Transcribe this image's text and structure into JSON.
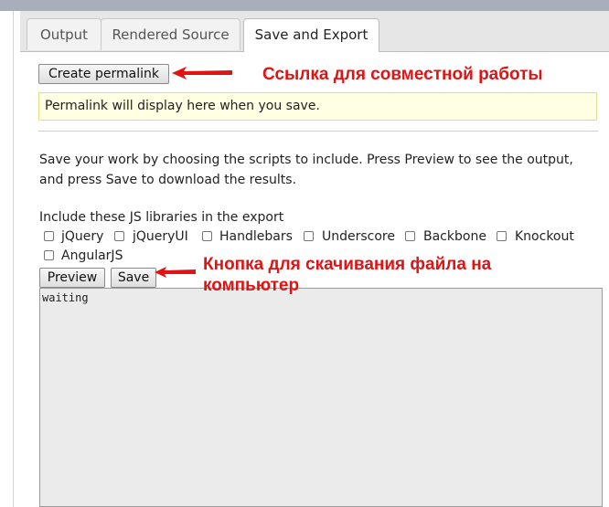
{
  "tabs": [
    {
      "label": "Output",
      "active": false
    },
    {
      "label": "Rendered Source",
      "active": false
    },
    {
      "label": "Save and Export",
      "active": true
    }
  ],
  "permalink": {
    "button_label": "Create permalink",
    "placeholder_text": "Permalink will display here when you save."
  },
  "description": "Save your work by choosing the scripts to include. Press Preview to see the output, and press Save to download the results.",
  "libraries": {
    "label": "Include these JS libraries in the export",
    "items": [
      {
        "label": "jQuery",
        "checked": false
      },
      {
        "label": "jQueryUI",
        "checked": false
      },
      {
        "label": "Handlebars",
        "checked": false
      },
      {
        "label": "Underscore",
        "checked": false
      },
      {
        "label": "Backbone",
        "checked": false
      },
      {
        "label": "Knockout",
        "checked": false
      },
      {
        "label": "AngularJS",
        "checked": false
      }
    ]
  },
  "actions": {
    "preview_label": "Preview",
    "save_label": "Save"
  },
  "output_text": "waiting",
  "annotations": {
    "permalink_note": "Ссылка для совместной работы",
    "save_note_line1": "Кнопка для скачивания файла на",
    "save_note_line2": "компьютер"
  },
  "colors": {
    "annotation": "#e31212",
    "permalink_box_bg": "#ffffe4",
    "output_bg": "#ebebeb",
    "topbar": "#a9aebb"
  }
}
